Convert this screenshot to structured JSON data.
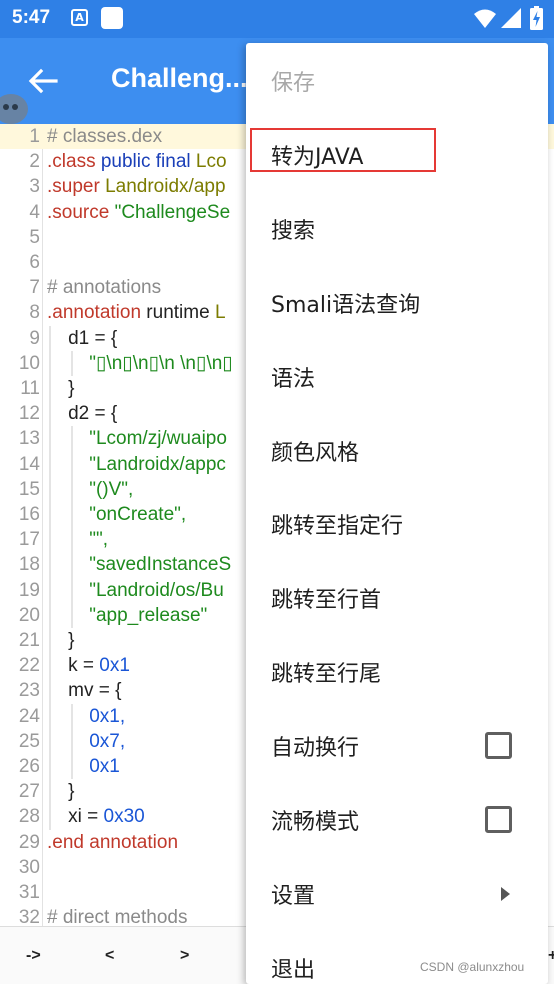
{
  "status_bar": {
    "time": "5:47",
    "a_icon_glyph": "A"
  },
  "app_bar": {
    "title": "Challeng..."
  },
  "editor": {
    "lines": [
      {
        "n": "1",
        "segments": [
          {
            "t": "# classes.dex",
            "c": "c-comment"
          }
        ]
      },
      {
        "n": "2",
        "segments": [
          {
            "t": ".class",
            "c": "c-kw"
          },
          {
            "t": " public final ",
            "c": "c-blue"
          },
          {
            "t": "Lco",
            "c": "c-type"
          }
        ]
      },
      {
        "n": "3",
        "segments": [
          {
            "t": ".super",
            "c": "c-kw"
          },
          {
            "t": " Landroidx/app",
            "c": "c-type"
          }
        ]
      },
      {
        "n": "4",
        "segments": [
          {
            "t": ".source",
            "c": "c-kw"
          },
          {
            "t": " \"ChallengeSe",
            "c": "c-str"
          }
        ]
      },
      {
        "n": "5",
        "segments": []
      },
      {
        "n": "6",
        "segments": []
      },
      {
        "n": "7",
        "segments": [
          {
            "t": "# annotations",
            "c": "c-comment"
          }
        ]
      },
      {
        "n": "8",
        "segments": [
          {
            "t": ".annotation",
            "c": "c-kw"
          },
          {
            "t": " runtime ",
            "c": "c-plain"
          },
          {
            "t": "L",
            "c": "c-type"
          }
        ]
      },
      {
        "n": "9",
        "segments": [
          {
            "t": "    d1 = {",
            "c": "c-plain"
          }
        ]
      },
      {
        "n": "10",
        "segments": [
          {
            "t": "        \"▯\\n▯\\n▯\\n \\n▯\\n▯",
            "c": "c-str"
          }
        ]
      },
      {
        "n": "11",
        "segments": [
          {
            "t": "    }",
            "c": "c-plain"
          }
        ]
      },
      {
        "n": "12",
        "segments": [
          {
            "t": "    d2 = {",
            "c": "c-plain"
          }
        ]
      },
      {
        "n": "13",
        "segments": [
          {
            "t": "        \"Lcom/zj/wuaipo",
            "c": "c-str"
          }
        ]
      },
      {
        "n": "14",
        "segments": [
          {
            "t": "        \"Landroidx/appc",
            "c": "c-str"
          }
        ]
      },
      {
        "n": "15",
        "segments": [
          {
            "t": "        \"()V\",",
            "c": "c-str"
          }
        ]
      },
      {
        "n": "16",
        "segments": [
          {
            "t": "        \"onCreate\",",
            "c": "c-str"
          }
        ]
      },
      {
        "n": "17",
        "segments": [
          {
            "t": "        \"\",",
            "c": "c-str"
          }
        ]
      },
      {
        "n": "18",
        "segments": [
          {
            "t": "        \"savedInstanceS",
            "c": "c-str"
          }
        ]
      },
      {
        "n": "19",
        "segments": [
          {
            "t": "        \"Landroid/os/Bu",
            "c": "c-str"
          }
        ]
      },
      {
        "n": "20",
        "segments": [
          {
            "t": "        \"app_release\"",
            "c": "c-str"
          }
        ]
      },
      {
        "n": "21",
        "segments": [
          {
            "t": "    }",
            "c": "c-plain"
          }
        ]
      },
      {
        "n": "22",
        "segments": [
          {
            "t": "    k = ",
            "c": "c-plain"
          },
          {
            "t": "0x1",
            "c": "c-num"
          }
        ]
      },
      {
        "n": "23",
        "segments": [
          {
            "t": "    mv = {",
            "c": "c-plain"
          }
        ]
      },
      {
        "n": "24",
        "segments": [
          {
            "t": "        0x1,",
            "c": "c-num"
          }
        ]
      },
      {
        "n": "25",
        "segments": [
          {
            "t": "        0x7,",
            "c": "c-num"
          }
        ]
      },
      {
        "n": "26",
        "segments": [
          {
            "t": "        0x1",
            "c": "c-num"
          }
        ]
      },
      {
        "n": "27",
        "segments": [
          {
            "t": "    }",
            "c": "c-plain"
          }
        ]
      },
      {
        "n": "28",
        "segments": [
          {
            "t": "    xi = ",
            "c": "c-plain"
          },
          {
            "t": "0x30",
            "c": "c-num"
          }
        ]
      },
      {
        "n": "29",
        "segments": [
          {
            "t": ".end annotation",
            "c": "c-kw"
          }
        ]
      },
      {
        "n": "30",
        "segments": []
      },
      {
        "n": "31",
        "segments": []
      },
      {
        "n": "32",
        "segments": [
          {
            "t": "# direct methods",
            "c": "c-comment"
          }
        ]
      }
    ]
  },
  "symbol_bar": {
    "keys": [
      "->",
      "<",
      ">",
      "+"
    ]
  },
  "menu": {
    "items": [
      {
        "label": "保存",
        "disabled": true,
        "type": "plain"
      },
      {
        "label": "转为JAVA",
        "disabled": false,
        "type": "plain"
      },
      {
        "label": "搜索",
        "disabled": false,
        "type": "plain"
      },
      {
        "label": "Smali语法查询",
        "disabled": false,
        "type": "plain"
      },
      {
        "label": "语法",
        "disabled": false,
        "type": "plain"
      },
      {
        "label": "颜色风格",
        "disabled": false,
        "type": "plain"
      },
      {
        "label": "跳转至指定行",
        "disabled": false,
        "type": "plain"
      },
      {
        "label": "跳转至行首",
        "disabled": false,
        "type": "plain"
      },
      {
        "label": "跳转至行尾",
        "disabled": false,
        "type": "plain"
      },
      {
        "label": "自动换行",
        "disabled": false,
        "type": "checkbox",
        "checked": false
      },
      {
        "label": "流畅模式",
        "disabled": false,
        "type": "checkbox",
        "checked": false
      },
      {
        "label": "设置",
        "disabled": false,
        "type": "submenu"
      },
      {
        "label": "退出",
        "disabled": false,
        "type": "plain"
      }
    ]
  },
  "watermark": "CSDN @alunxzhou",
  "colors": {
    "status_bar": "#2f80e6",
    "app_bar": "#3d8ef0",
    "highlight_box": "#e53935"
  }
}
